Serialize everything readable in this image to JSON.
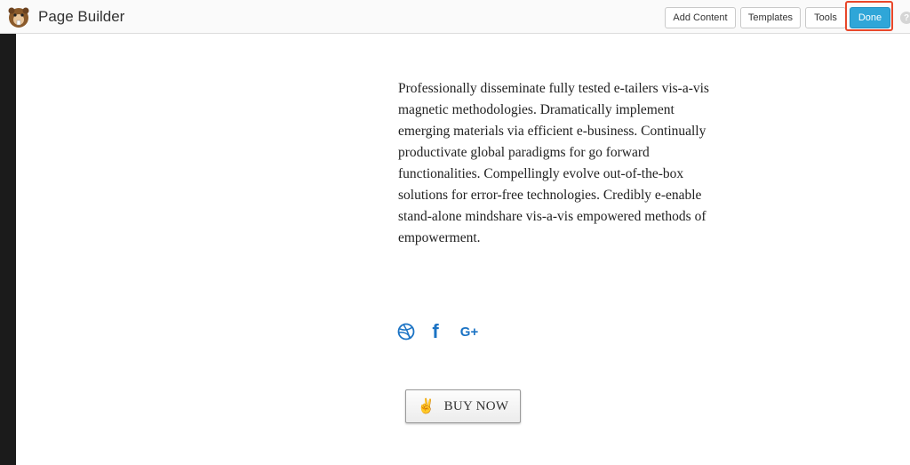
{
  "app": {
    "title": "Page Builder",
    "logo_icon": "beaver-logo-icon"
  },
  "toolbar": {
    "add_content_label": "Add Content",
    "templates_label": "Templates",
    "tools_label": "Tools",
    "done_label": "Done",
    "help_label": "?"
  },
  "content": {
    "paragraph": "Professionally disseminate fully tested e-tailers vis-a-vis magnetic methodologies. Dramatically implement emerging materials via efficient e-business. Continually productivate global paradigms for go forward functionalities. Compellingly evolve out-of-the-box solutions for error-free technologies. Credibly e-enable stand-alone mindshare vis-a-vis empowered methods of empowerment.",
    "social_icons": [
      "dribbble-icon",
      "facebook-icon",
      "google-plus-icon"
    ],
    "facebook_glyph": "f",
    "gplus_glyph": "G+",
    "buy_button": {
      "icon": "victory-hand-icon",
      "icon_glyph": "✌",
      "label": "BUY NOW"
    }
  },
  "colors": {
    "done_button": "#2fa6d8",
    "highlight_box": "#e8472a",
    "social_icon": "#1b73c4"
  }
}
